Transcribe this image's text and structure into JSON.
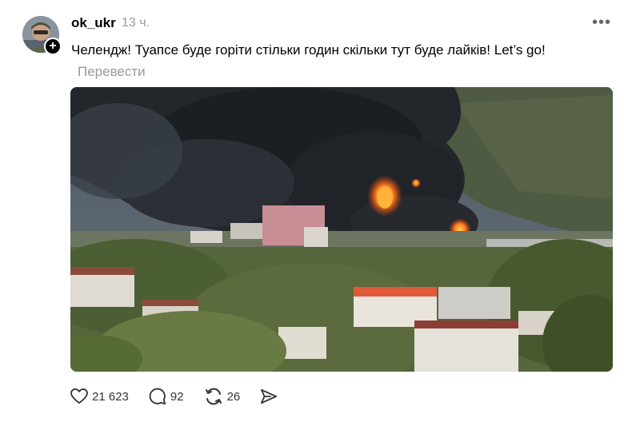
{
  "post": {
    "username": "ok_ukr",
    "timestamp": "13 ч.",
    "text": "Челендж! Туапсе буде горіти стільки годин скільки тут буде лайків! Let’s go!",
    "translate_label": "Перевести",
    "photo_icon": "smoke-fire-city-photo"
  },
  "actions": {
    "likes": "21 623",
    "comments": "92",
    "reposts": "26"
  },
  "icons": {
    "like": "heart-icon",
    "comment": "comment-icon",
    "repost": "repost-icon",
    "share": "send-icon",
    "more": "more-icon",
    "follow": "plus-icon"
  }
}
